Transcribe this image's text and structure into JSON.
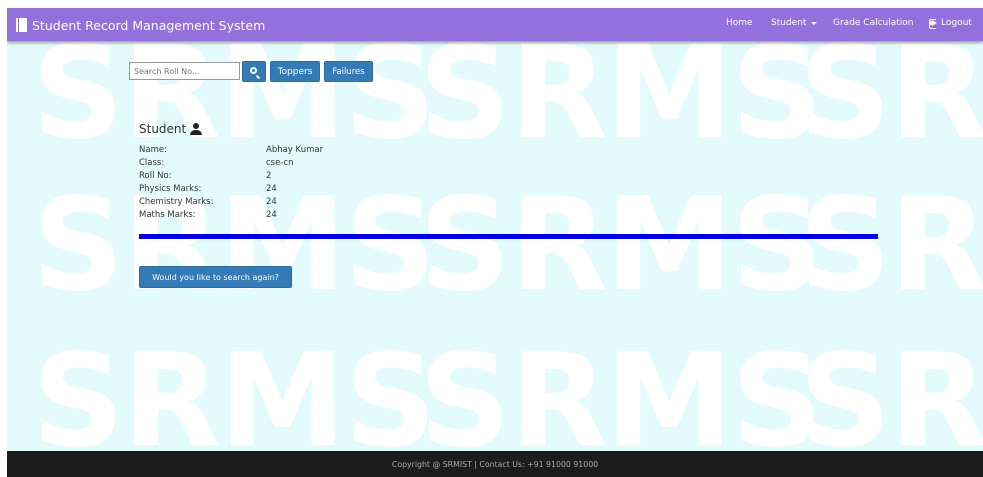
{
  "app": {
    "title": "Student Record Management System"
  },
  "nav": {
    "home": "Home",
    "student": "Student",
    "grade": "Grade Calculation",
    "logout": "Logout"
  },
  "search": {
    "placeholder": "Search Roll No...",
    "toppers_label": "Toppers",
    "failures_label": "Failures",
    "search_icon": "search-icon"
  },
  "student": {
    "heading": "Student",
    "fields": [
      {
        "label": "Name:",
        "value": "Abhay Kumar"
      },
      {
        "label": "Class:",
        "value": "cse-cn"
      },
      {
        "label": "Roll No:",
        "value": "2"
      },
      {
        "label": "Physics Marks:",
        "value": "24"
      },
      {
        "label": "Chemistry Marks:",
        "value": "24"
      },
      {
        "label": "Maths Marks:",
        "value": "24"
      }
    ]
  },
  "actions": {
    "search_again": "Would you like to search again?"
  },
  "watermark": {
    "text": "SRMS"
  },
  "footer": {
    "text": "Copyright @ SRMIST | Contact Us: +91 91000 91000"
  },
  "colors": {
    "navbar": "#9370db",
    "background": "#e3fbfd",
    "button": "#337ab7",
    "divider": "#0000ee",
    "footer": "#1c1c1c"
  }
}
